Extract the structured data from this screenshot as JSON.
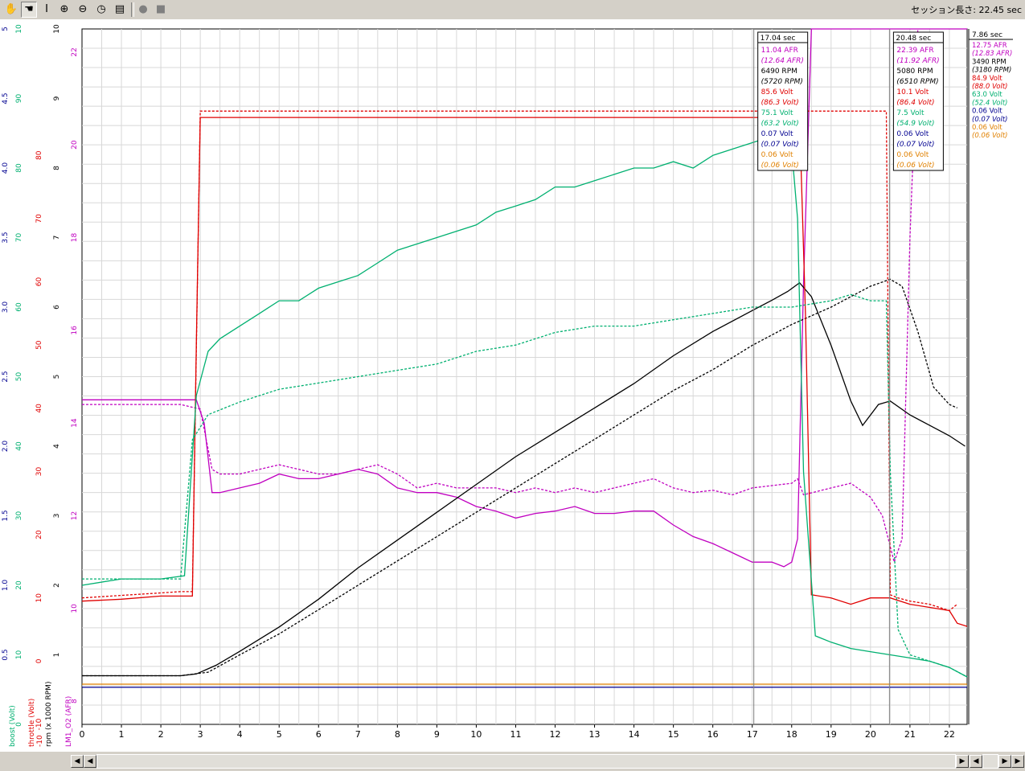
{
  "toolbar": {
    "tools": [
      "hand-tool",
      "grab-tool",
      "text-cursor-tool",
      "zoom-in-tool",
      "zoom-out-tool",
      "dial-tool",
      "notepad-tool",
      "record-tool",
      "stop-tool"
    ],
    "session_label": "セッション長さ: 22.45 sec"
  },
  "colors": {
    "afr": "#c000c0",
    "rpm": "#000000",
    "throttle": "#e00000",
    "boost": "#00b070",
    "volt_blue": "#000090",
    "volt_orange": "#e08000",
    "grid": "#d8d8d8",
    "cursor_line": "#808080"
  },
  "chart_data": {
    "type": "line",
    "xlabel": "",
    "xlim": [
      0,
      22.45
    ],
    "x_ticks": [
      "0",
      "1",
      "2",
      "3",
      "4",
      "5",
      "6",
      "7",
      "8",
      "9",
      "10",
      "11",
      "12",
      "13",
      "14",
      "15",
      "16",
      "17",
      "18",
      "19",
      "20",
      "21",
      "22"
    ],
    "axes": [
      {
        "name": "boost (Volt)",
        "color": "#000090",
        "range": [
          0,
          5
        ],
        "ticks": [
          "0.5",
          "1.0",
          "1.5",
          "2.0",
          "2.5",
          "3.0",
          "3.5",
          "4.0",
          "4.5",
          "5"
        ]
      },
      {
        "name": "throttle (Volt)",
        "color": "#00b070",
        "range": [
          0,
          100
        ],
        "ticks": [
          "0",
          "10",
          "20",
          "30",
          "40",
          "50",
          "60",
          "70",
          "80",
          "90",
          "10"
        ]
      },
      {
        "name": "rpm (x 1000 RPM)",
        "color": "#e00000",
        "range": [
          -10,
          100
        ],
        "ticks": [
          "-10",
          "0",
          "10",
          "20",
          "30",
          "40",
          "50",
          "60",
          "70",
          "80"
        ]
      },
      {
        "name": "LM1_O2 (AFR)",
        "color": "#000000",
        "range": [
          0,
          10
        ],
        "ticks": [
          "1",
          "2",
          "3",
          "4",
          "5",
          "6",
          "7",
          "8",
          "9",
          "10"
        ]
      },
      {
        "name": "",
        "color": "#c000c0",
        "range": [
          7.5,
          22.5
        ],
        "ticks": [
          "8",
          "10",
          "12",
          "14",
          "16",
          "18",
          "20",
          "22"
        ]
      }
    ],
    "axis_titles": [
      "boost (Volt)",
      "throttle (Volt)",
      "-10",
      "rpm (x 1000 RPM)",
      "LM1_O2 (AFR)"
    ],
    "series": [
      {
        "name": "AFR",
        "color": "#c000c0",
        "style": "solid",
        "x": [
          0,
          2.5,
          2.9,
          3.1,
          3.3,
          3.5,
          4,
          4.5,
          5,
          5.5,
          6,
          6.5,
          7,
          7.5,
          8,
          8.5,
          9,
          9.5,
          10,
          10.5,
          11,
          11.5,
          12,
          12.5,
          13,
          13.5,
          14,
          14.5,
          15,
          15.5,
          16,
          16.5,
          17,
          17.5,
          17.8,
          18,
          18.15,
          18.3,
          18.5,
          22.45
        ],
        "y": [
          14.5,
          14.5,
          14.5,
          14,
          12.5,
          12.5,
          12.6,
          12.7,
          12.9,
          12.8,
          12.8,
          12.9,
          13,
          12.9,
          12.6,
          12.5,
          12.5,
          12.4,
          12.2,
          12.1,
          11.95,
          12.05,
          12.1,
          12.2,
          12.05,
          12.05,
          12.1,
          12.1,
          11.8,
          11.55,
          11.4,
          11.2,
          11,
          11,
          10.9,
          11,
          11.5,
          17,
          22.5,
          22.5
        ]
      },
      {
        "name": "AFR (ref)",
        "color": "#c000c0",
        "style": "dashed",
        "x": [
          0,
          2.5,
          3,
          3.3,
          3.5,
          4,
          4.5,
          5,
          5.5,
          6,
          6.5,
          7,
          7.5,
          8,
          8.5,
          9,
          9.5,
          10,
          10.5,
          11,
          11.5,
          12,
          12.5,
          13,
          13.5,
          14,
          14.5,
          15,
          15.5,
          16,
          16.5,
          17,
          17.5,
          18,
          18.15,
          18.3,
          19,
          19.5,
          20,
          20.3,
          20.6,
          20.8,
          21,
          21.2
        ],
        "y": [
          14.4,
          14.4,
          14.3,
          13,
          12.9,
          12.9,
          13,
          13.1,
          13,
          12.9,
          12.9,
          13,
          13.1,
          12.9,
          12.6,
          12.7,
          12.6,
          12.6,
          12.6,
          12.5,
          12.6,
          12.5,
          12.6,
          12.5,
          12.6,
          12.7,
          12.8,
          12.6,
          12.5,
          12.55,
          12.45,
          12.6,
          12.65,
          12.7,
          12.8,
          12.45,
          12.6,
          12.7,
          12.4,
          12,
          11,
          11.5,
          18,
          22.5
        ]
      },
      {
        "name": "RPM",
        "color": "#000000",
        "style": "solid",
        "x": [
          0,
          2.5,
          2.9,
          3.4,
          4,
          5,
          6,
          7,
          8,
          9,
          10,
          11,
          12,
          13,
          14,
          15,
          16,
          17,
          17.5,
          17.9,
          18.2,
          18.5,
          19,
          19.5,
          19.8,
          20.2,
          20.5,
          21,
          21.5,
          22,
          22.4
        ],
        "y": [
          1.4,
          1.4,
          1.45,
          1.7,
          2.1,
          2.8,
          3.6,
          4.5,
          5.3,
          6.1,
          6.9,
          7.7,
          8.4,
          9.1,
          9.8,
          10.6,
          11.3,
          11.9,
          12.2,
          12.45,
          12.7,
          12.3,
          10.9,
          9.3,
          8.6,
          9.2,
          9.3,
          8.9,
          8.6,
          8.3,
          8.0
        ]
      },
      {
        "name": "RPM (ref)",
        "color": "#000000",
        "style": "dashed",
        "x": [
          0,
          2.5,
          3.2,
          4,
          5,
          6,
          7,
          8,
          9,
          10,
          11,
          12,
          13,
          14,
          15,
          16,
          17,
          18,
          19,
          19.5,
          20,
          20.5,
          20.8,
          21.2,
          21.6,
          22,
          22.2
        ],
        "y": [
          1.4,
          1.4,
          1.5,
          2.0,
          2.6,
          3.3,
          4.0,
          4.7,
          5.4,
          6.1,
          6.8,
          7.5,
          8.2,
          8.9,
          9.6,
          10.2,
          10.9,
          11.5,
          12.0,
          12.3,
          12.6,
          12.8,
          12.6,
          11.3,
          9.7,
          9.2,
          9.1
        ]
      },
      {
        "name": "Throttle",
        "color": "#e00000",
        "style": "solid",
        "x": [
          0,
          1,
          2,
          2.8,
          2.9,
          3.0,
          10,
          17.5,
          18.2,
          18.35,
          18.5,
          19,
          19.5,
          20,
          20.5,
          21,
          21.5,
          22,
          22.2,
          22.45
        ],
        "y": [
          9.5,
          9.8,
          10.3,
          10.3,
          50,
          86,
          86,
          86,
          86,
          55,
          10.5,
          10,
          9,
          10,
          10,
          9,
          8.5,
          8,
          6,
          5.5
        ]
      },
      {
        "name": "Throttle (ref)",
        "color": "#e00000",
        "style": "dashed",
        "x": [
          0,
          2.5,
          2.8,
          3.0,
          10,
          20.4,
          20.5,
          20.7,
          21,
          21.5,
          22,
          22.2
        ],
        "y": [
          10,
          11,
          11,
          87,
          87,
          87,
          10.5,
          10,
          9.5,
          9,
          8,
          9
        ]
      },
      {
        "name": "Boost",
        "color": "#00b070",
        "style": "solid",
        "x": [
          0,
          1,
          2,
          2.6,
          2.9,
          3.2,
          3.5,
          4,
          4.5,
          5,
          5.5,
          6,
          6.5,
          7,
          7.5,
          8,
          8.5,
          9,
          9.5,
          10,
          10.5,
          11,
          11.5,
          12,
          12.5,
          13,
          13.5,
          14,
          14.5,
          15,
          15.5,
          16,
          16.5,
          17,
          17.5,
          18,
          18.15,
          18.3,
          18.6,
          19,
          19.5,
          20,
          20.5,
          21,
          21.5,
          22,
          22.45
        ],
        "y": [
          12,
          13,
          13,
          13.5,
          42,
          49,
          51,
          53,
          55,
          57,
          57,
          59,
          60,
          61,
          63,
          65,
          66,
          67,
          68,
          69,
          71,
          72,
          73,
          75,
          75,
          76,
          77,
          78,
          78,
          79,
          78,
          80,
          81,
          82,
          83,
          81,
          70,
          30,
          4,
          3,
          2,
          1.5,
          1,
          0.5,
          0,
          -1,
          -2.5
        ]
      },
      {
        "name": "Boost (ref)",
        "color": "#00b070",
        "style": "dashed",
        "x": [
          0,
          2.5,
          2.8,
          3.2,
          4,
          5,
          6,
          7,
          8,
          9,
          10,
          11,
          12,
          13,
          14,
          15,
          16,
          17,
          18,
          19,
          19.5,
          20,
          20.4,
          20.5,
          20.7,
          21,
          21.5,
          22,
          22.45
        ],
        "y": [
          13,
          13,
          35,
          39,
          41,
          43,
          44,
          45,
          46,
          47,
          49,
          50,
          52,
          53,
          53,
          54,
          55,
          56,
          56,
          57,
          58,
          57,
          57,
          30,
          5,
          1,
          0,
          -1,
          -2.5
        ]
      },
      {
        "name": "Volt (blue)",
        "color": "#000090",
        "style": "solid",
        "x": [
          0,
          22.45
        ],
        "y": [
          0.06,
          0.06
        ]
      },
      {
        "name": "Volt (orange)",
        "color": "#e08000",
        "style": "solid",
        "x": [
          0,
          22.45
        ],
        "y": [
          0.06,
          0.06
        ]
      }
    ],
    "cursors": [
      {
        "x": 17.04,
        "label": "17.04 sec",
        "values": [
          "11.04 AFR",
          "(12.64 AFR)",
          "6490 RPM",
          "(5720 RPM)",
          "85.6 Volt",
          "(86.3 Volt)",
          "75.1 Volt",
          "(63.2 Volt)",
          "0.07 Volt",
          "(0.07 Volt)",
          "0.06 Volt",
          "(0.06 Volt)"
        ]
      },
      {
        "x": 20.48,
        "label": "20.48 sec",
        "values": [
          "22.39 AFR",
          "(11.92 AFR)",
          "5080 RPM",
          "(6510 RPM)",
          "10.1 Volt",
          "(86.4 Volt)",
          "7.5 Volt",
          "(54.9 Volt)",
          "0.06 Volt",
          "(0.07 Volt)",
          "0.06 Volt",
          "(0.06 Volt)"
        ]
      }
    ],
    "side_panel": {
      "label": "7.86 sec",
      "values": [
        "12.75 AFR",
        "(12.83 AFR)",
        "3490 RPM",
        "(3180 RPM)",
        "84.9 Volt",
        "(88.0 Volt)",
        "63.0 Volt",
        "(52.4 Volt)",
        "0.06 Volt",
        "(0.07 Volt)",
        "0.06 Volt",
        "(0.06 Volt)"
      ]
    },
    "grid": true
  }
}
